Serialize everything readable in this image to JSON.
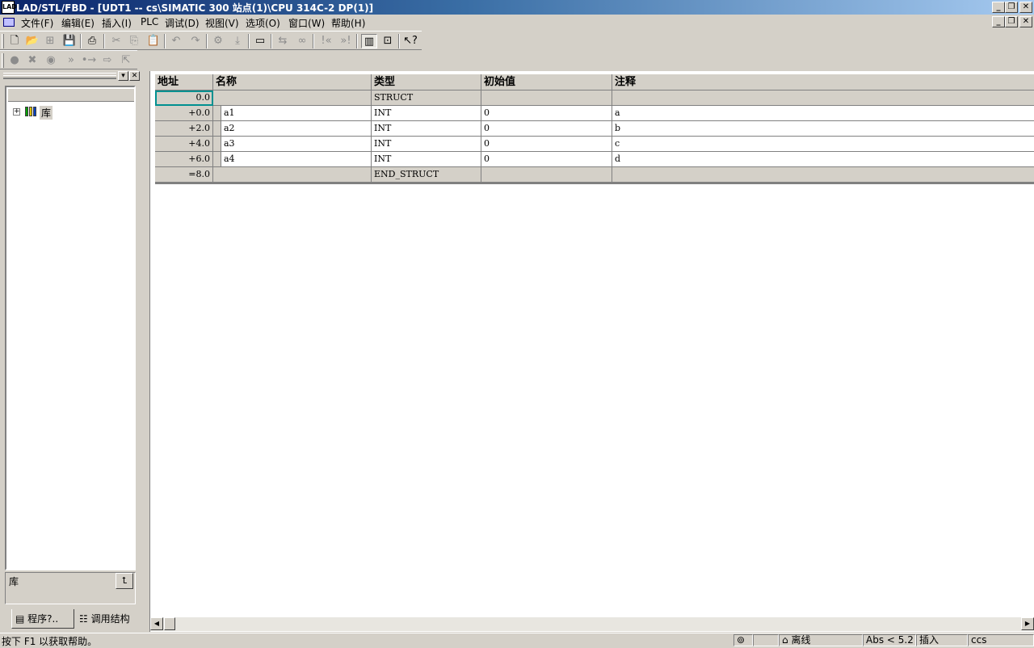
{
  "window": {
    "title": "LAD/STL/FBD  - [UDT1 -- cs\\SIMATIC 300 站点(1)\\CPU 314C-2 DP(1)]",
    "app_icon": "LAD"
  },
  "menubar": {
    "items": [
      "文件(F)",
      "编辑(E)",
      "插入(I)",
      "PLC",
      "调试(D)",
      "视图(V)",
      "选项(O)",
      "窗口(W)",
      "帮助(H)"
    ]
  },
  "toolbar1": {
    "icons": [
      "new-file-icon",
      "open-folder-icon",
      "network-icon",
      "save-icon",
      "print-icon",
      "cut-icon",
      "copy-icon",
      "paste-icon",
      "undo-icon",
      "redo-icon",
      "compile-icon",
      "download-icon",
      "monitor-icon",
      "compare-icon",
      "glasses-icon",
      "prev-error-icon",
      "next-error-icon",
      "overview-icon",
      "details-icon",
      "help-pointer-icon"
    ]
  },
  "toolbar2": {
    "icons": [
      "breakpoint-icon",
      "delete-breakpoint-icon",
      "breakpoint-active-icon",
      "next-statement-icon",
      "execute-call-icon",
      "step-over-icon",
      "step-out-icon"
    ]
  },
  "left_pane": {
    "tree": [
      {
        "label": "库",
        "icon": "library-icon",
        "expander": "+"
      }
    ],
    "info_text": "库",
    "tabs": [
      {
        "label": "程序?..",
        "icon": "program-elements-icon",
        "active": true
      },
      {
        "label": "调用结构",
        "icon": "call-structure-icon",
        "active": false
      }
    ]
  },
  "table": {
    "columns": [
      "地址",
      "名称",
      "类型",
      "初始值",
      "注释"
    ],
    "rows": [
      {
        "address": "0.0",
        "name": "",
        "type": "STRUCT",
        "initial": "",
        "comment": "",
        "kind": "struct"
      },
      {
        "address": "+0.0",
        "name": "a1",
        "type": "INT",
        "initial": "0",
        "comment": "a",
        "kind": "var"
      },
      {
        "address": "+2.0",
        "name": "a2",
        "type": "INT",
        "initial": "0",
        "comment": "b",
        "kind": "var"
      },
      {
        "address": "+4.0",
        "name": "a3",
        "type": "INT",
        "initial": "0",
        "comment": "c",
        "kind": "var"
      },
      {
        "address": "+6.0",
        "name": "a4",
        "type": "INT",
        "initial": "0",
        "comment": "d",
        "kind": "var"
      },
      {
        "address": "=8.0",
        "name": "",
        "type": "END_STRUCT",
        "initial": "",
        "comment": "",
        "kind": "struct"
      }
    ]
  },
  "statusbar": {
    "help_text": "按下 F1 以获取帮助。",
    "status": "离线",
    "position": "Abs < 5.2",
    "mode": "插入",
    "extra": "ccs"
  }
}
